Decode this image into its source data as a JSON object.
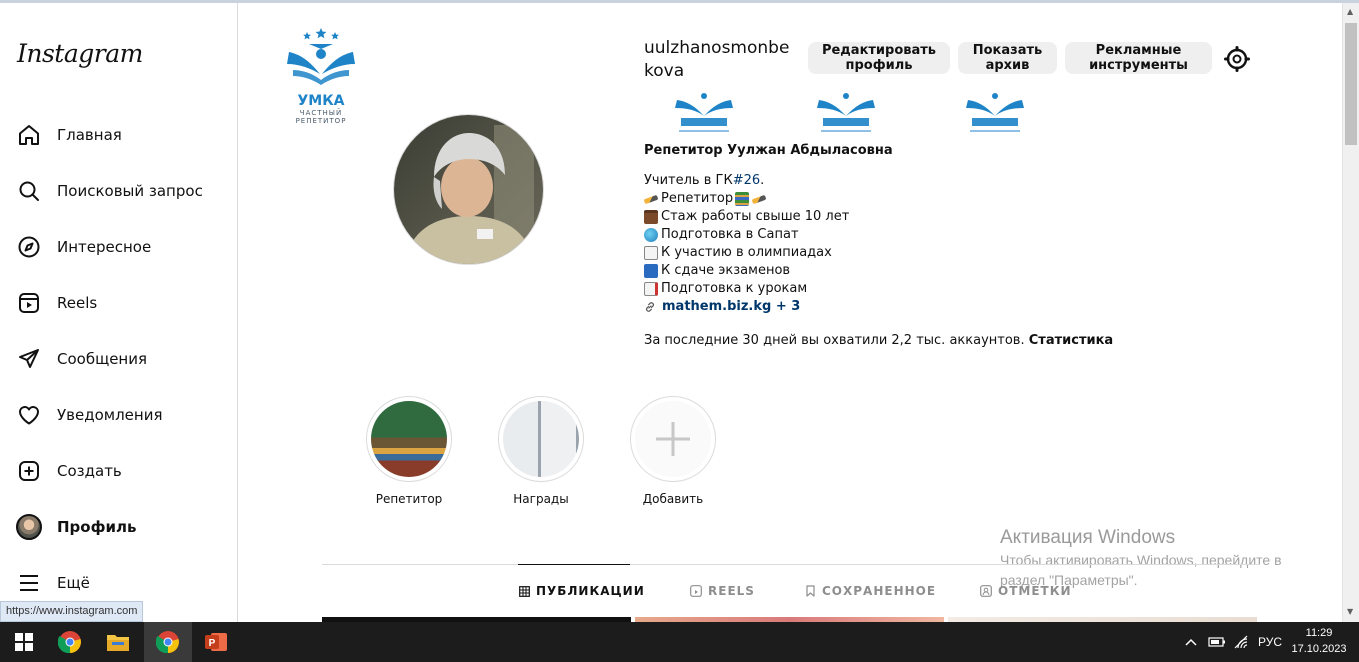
{
  "sidebar": {
    "logo": "Instagram",
    "items": [
      {
        "label": "Главная",
        "icon": "home-icon"
      },
      {
        "label": "Поисковый запрос",
        "icon": "search-icon"
      },
      {
        "label": "Интересное",
        "icon": "compass-icon"
      },
      {
        "label": "Reels",
        "icon": "reels-icon"
      },
      {
        "label": "Сообщения",
        "icon": "send-icon"
      },
      {
        "label": "Уведомления",
        "icon": "heart-icon"
      },
      {
        "label": "Создать",
        "icon": "plus-square-icon"
      },
      {
        "label": "Профиль",
        "icon": "avatar"
      },
      {
        "label": "Ещё",
        "icon": "menu-icon"
      }
    ]
  },
  "status_url": "https://www.instagram.com",
  "brand": {
    "name": "УМКА",
    "subtitle": "ЧАСТНЫЙ РЕПЕТИТОР"
  },
  "profile": {
    "username": "uulzhanosmonbekova",
    "buttons": {
      "edit": "Редактировать профиль",
      "archive": "Показать архив",
      "ads": "Рекламные инструменты"
    },
    "full_name": "Репетитор Уулжан Абдыласовна",
    "bio": {
      "line1_prefix": "Учитель в ГК ",
      "line1_tag": "#26",
      "line1_suffix": ".",
      "line2": "Репетитор",
      "line3": " Стаж работы свыше 10 лет",
      "line4": "Подготовка в Сапат",
      "line5": "К участию в олимпиадах",
      "line6": "К сдаче экзаменов",
      "line7": "Подготовка к урокам",
      "link": "mathem.biz.kg + 3"
    },
    "stats_text": "За последние 30 дней вы охватили 2,2 тыс. аккаунтов.",
    "stats_link": "Статистика"
  },
  "highlights": [
    {
      "label": "Репетитор"
    },
    {
      "label": "Награды"
    },
    {
      "label": "Добавить"
    }
  ],
  "tabs": [
    {
      "label": "ПУБЛИКАЦИИ",
      "icon": "grid-icon"
    },
    {
      "label": "REELS",
      "icon": "reels-icon"
    },
    {
      "label": "СОХРАНЕННОЕ",
      "icon": "bookmark-icon"
    },
    {
      "label": "ОТМЕТКИ",
      "icon": "tag-user-icon"
    }
  ],
  "watermark": {
    "title": "Активация Windows",
    "text": "Чтобы активировать Windows, перейдите в раздел \"Параметры\"."
  },
  "taskbar": {
    "language": "РУС",
    "time": "11:29",
    "date": "17.10.2023"
  },
  "colors": {
    "link": "#00376b",
    "brand_blue": "#1e84c7",
    "button_bg": "#efefef",
    "taskbar": "#1c1c1c"
  }
}
